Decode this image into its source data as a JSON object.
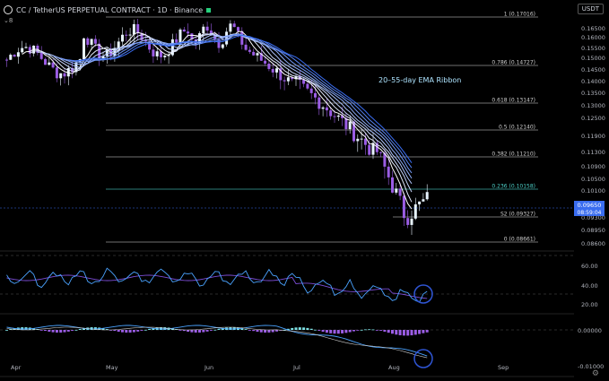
{
  "header": {
    "title": "CC / TetherUS PERPETUAL CONTRACT · 1D · Binance",
    "indicator_toggle": "8",
    "currency": "USDT"
  },
  "price_axis": {
    "ticks": [
      "0.16500",
      "0.16000",
      "0.15500",
      "0.15000",
      "0.14500",
      "0.14000",
      "0.13500",
      "0.13000",
      "0.12500",
      "0.11900",
      "0.11300",
      "0.10900",
      "0.10500",
      "0.10100",
      "0.09300",
      "0.08950",
      "0.08600"
    ],
    "current_price": "0.09650",
    "countdown": "08:59:04"
  },
  "fib_levels": [
    {
      "label": "1 (0.17016)",
      "value": 0.17016
    },
    {
      "label": "0.786 (0.14727)",
      "value": 0.14727
    },
    {
      "label": "0.618 (0.13147)",
      "value": 0.13147
    },
    {
      "label": "0.5 (0.12140)",
      "value": 0.1214
    },
    {
      "label": "0.382 (0.11210)",
      "value": 0.1121
    },
    {
      "label": "0.236 (0.10158)",
      "value": 0.10158
    },
    {
      "label": "S2 (0.09327)",
      "value": 0.09327
    },
    {
      "label": "0 (0.08661)",
      "value": 0.08661
    }
  ],
  "ribbon_label": "20–55-day EMA Ribbon",
  "rsi_axis": {
    "ticks": [
      "60.00",
      "40.00",
      "20.00"
    ]
  },
  "macd_axis": {
    "ticks": [
      "0.00000",
      "-0.01000"
    ]
  },
  "time_axis": {
    "labels": [
      "Apr",
      "May",
      "Jun",
      "Jul",
      "Aug",
      "Sep"
    ]
  },
  "colors": {
    "background": "#000000",
    "bull": "#e8f4ff",
    "bear": "#9b5de5",
    "ribbon_top": "#ffffff",
    "ribbon_bottom": "#3a6df0",
    "fib_line": "#bbbbbb",
    "fib_highlight": "#4dd0c8",
    "rsi_line": "#4aa3ff",
    "rsi_signal": "#7b4dd6",
    "circle": "#2f55d4"
  }
}
